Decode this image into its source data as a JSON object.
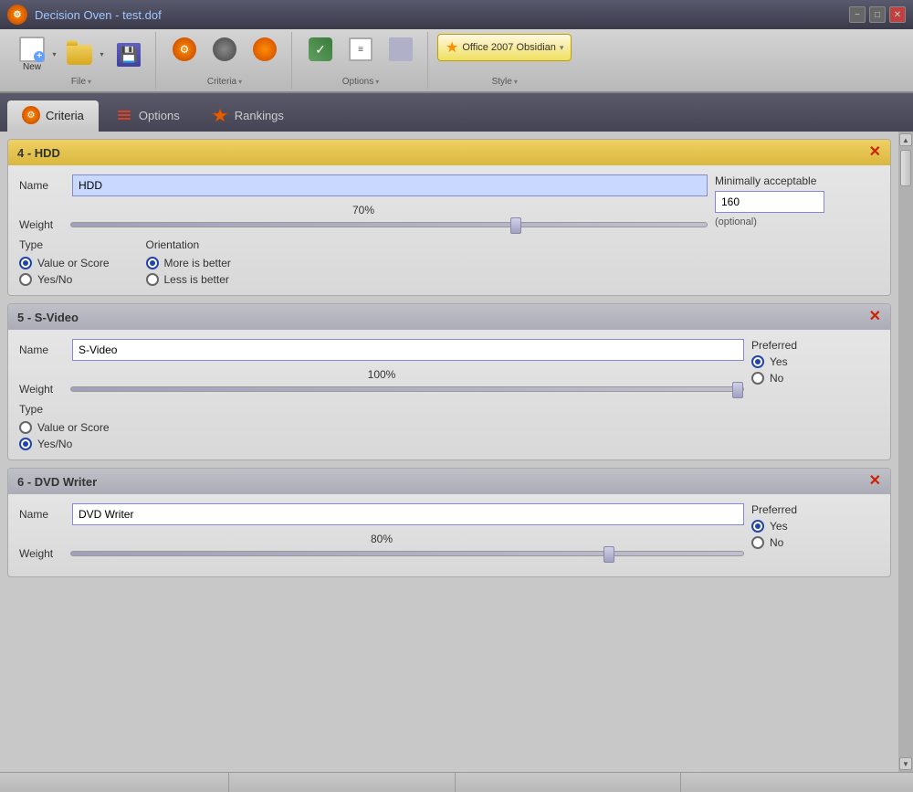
{
  "titleBar": {
    "title": "Decision Oven - test.dof",
    "minLabel": "−",
    "maxLabel": "□",
    "closeLabel": "✕"
  },
  "toolbar": {
    "groups": [
      {
        "name": "File",
        "items": [
          {
            "id": "new",
            "label": "New",
            "icon": "new-icon"
          },
          {
            "id": "open",
            "label": "",
            "icon": "folder-icon"
          },
          {
            "id": "save",
            "label": "",
            "icon": "save-icon"
          }
        ]
      },
      {
        "name": "Criteria",
        "items": [
          {
            "id": "criteria1",
            "label": "",
            "icon": "gear-icon"
          },
          {
            "id": "criteria2",
            "label": "",
            "icon": "circle-dark-icon"
          },
          {
            "id": "criteria3",
            "label": "",
            "icon": "circle-orange-icon"
          }
        ]
      },
      {
        "name": "Options",
        "items": [
          {
            "id": "options1",
            "label": "",
            "icon": "pencil-check-icon"
          },
          {
            "id": "options2",
            "label": "",
            "icon": "page-icon"
          },
          {
            "id": "options3",
            "label": "",
            "icon": "page2-icon"
          }
        ]
      },
      {
        "name": "Style",
        "items": [
          {
            "id": "style",
            "label": "Office 2007 Obsidian",
            "icon": "star-icon"
          }
        ]
      }
    ]
  },
  "tabs": [
    {
      "id": "criteria",
      "label": "Criteria",
      "active": true,
      "icon": "criteria-tab-icon"
    },
    {
      "id": "options",
      "label": "Options",
      "active": false,
      "icon": "options-tab-icon"
    },
    {
      "id": "rankings",
      "label": "Rankings",
      "active": false,
      "icon": "rankings-tab-icon"
    }
  ],
  "criteriaCards": [
    {
      "id": "card-hdd",
      "headerLabel": "4 - HDD",
      "nameValue": "HDD",
      "nameSelected": true,
      "weightPercent": "70%",
      "weightThumbPos": "70",
      "rightPanelLabel": "Minimally acceptable",
      "rightPanelValue": "160",
      "rightPanelNote": "(optional)",
      "typeLabel": "Type",
      "typeOptions": [
        {
          "label": "Value or Score",
          "selected": true
        },
        {
          "label": "Yes/No",
          "selected": false
        }
      ],
      "orientationLabel": "Orientation",
      "orientationOptions": [
        {
          "label": "More is better",
          "selected": true
        },
        {
          "label": "Less is better",
          "selected": false
        }
      ]
    },
    {
      "id": "card-svideo",
      "headerLabel": "5 - S-Video",
      "nameValue": "S-Video",
      "nameSelected": false,
      "weightPercent": "100%",
      "weightThumbPos": "100",
      "rightPanelLabel": "Preferred",
      "preferredOptions": [
        {
          "label": "Yes",
          "selected": true
        },
        {
          "label": "No",
          "selected": false
        }
      ],
      "typeLabel": "Type",
      "typeOptions": [
        {
          "label": "Value or Score",
          "selected": false
        },
        {
          "label": "Yes/No",
          "selected": true
        }
      ]
    },
    {
      "id": "card-dvdwriter",
      "headerLabel": "6 - DVD Writer",
      "nameValue": "DVD Writer",
      "nameSelected": false,
      "weightPercent": "80%",
      "weightThumbPos": "80",
      "rightPanelLabel": "Preferred",
      "preferredOptions": [
        {
          "label": "Yes",
          "selected": true
        },
        {
          "label": "No",
          "selected": false
        }
      ]
    }
  ],
  "statusBar": {
    "segments": [
      "",
      "",
      "",
      ""
    ]
  }
}
